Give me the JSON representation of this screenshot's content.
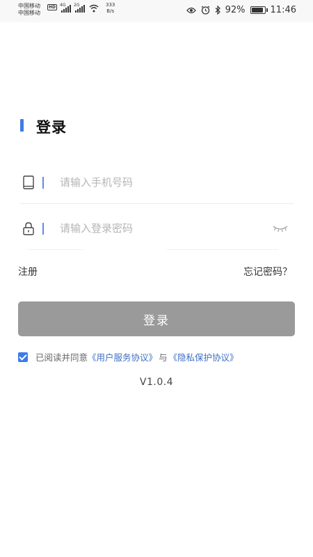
{
  "status_bar": {
    "carrier_1": "中国移动",
    "carrier_2": "中国移动",
    "hd_badge": "HD",
    "network_1": "4G",
    "network_2": "2G",
    "speed_value": "333",
    "speed_unit": "B/s",
    "battery_percent": "92%",
    "battery_level": 0.92,
    "time": "11:46",
    "icons": [
      "eye-icon",
      "alarm-icon",
      "bluetooth-icon",
      "battery-icon",
      "wifi-icon",
      "signal-icon"
    ]
  },
  "login": {
    "title": "登录",
    "phone_placeholder": "请输入手机号码",
    "password_placeholder": "请输入登录密码",
    "register_label": "注册",
    "forgot_label": "忘记密码？",
    "login_button": "登录",
    "agreement_prefix": "已阅读并同意",
    "user_agreement": "《用户服务协议》",
    "agreement_and": "与",
    "privacy_policy": "《隐私保护协议》",
    "agreement_checked": true,
    "version": "V1.0.4"
  },
  "colors": {
    "accent": "#3d7be8",
    "button_disabled": "#9a9a9a",
    "link": "#3d6fc4"
  }
}
